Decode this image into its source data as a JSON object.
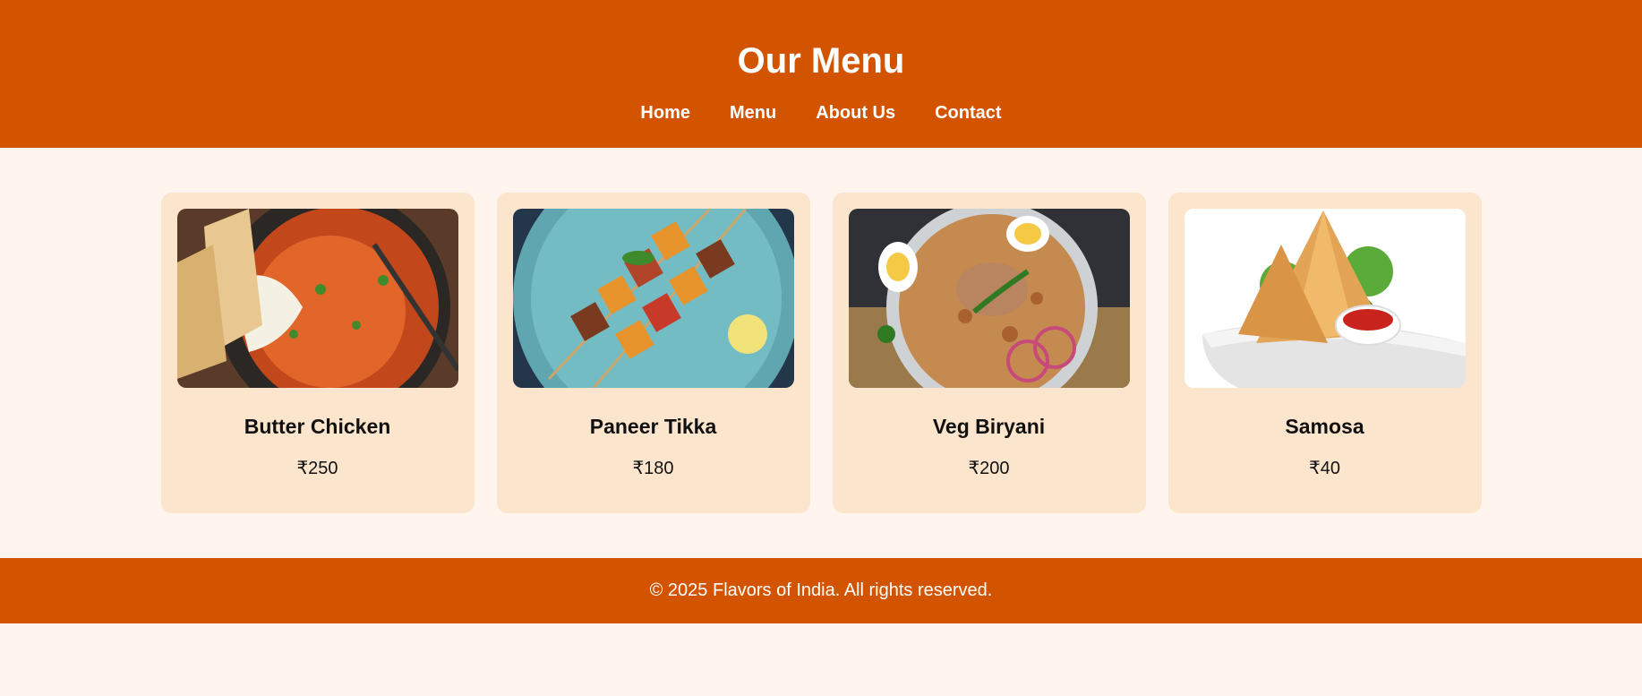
{
  "header": {
    "title": "Our Menu",
    "nav": [
      {
        "label": "Home"
      },
      {
        "label": "Menu"
      },
      {
        "label": "About Us"
      },
      {
        "label": "Contact"
      }
    ]
  },
  "menu": {
    "items": [
      {
        "name": "Butter Chicken",
        "price": "₹250",
        "image": "butter-chicken-image"
      },
      {
        "name": "Paneer Tikka",
        "price": "₹180",
        "image": "paneer-tikka-image"
      },
      {
        "name": "Veg Biryani",
        "price": "₹200",
        "image": "veg-biryani-image"
      },
      {
        "name": "Samosa",
        "price": "₹40",
        "image": "samosa-image"
      }
    ]
  },
  "footer": {
    "text": "© 2025 Flavors of India. All rights reserved."
  },
  "colors": {
    "brand": "#d35400",
    "page_background": "#fff5ee",
    "card_background": "#fce5cd"
  }
}
